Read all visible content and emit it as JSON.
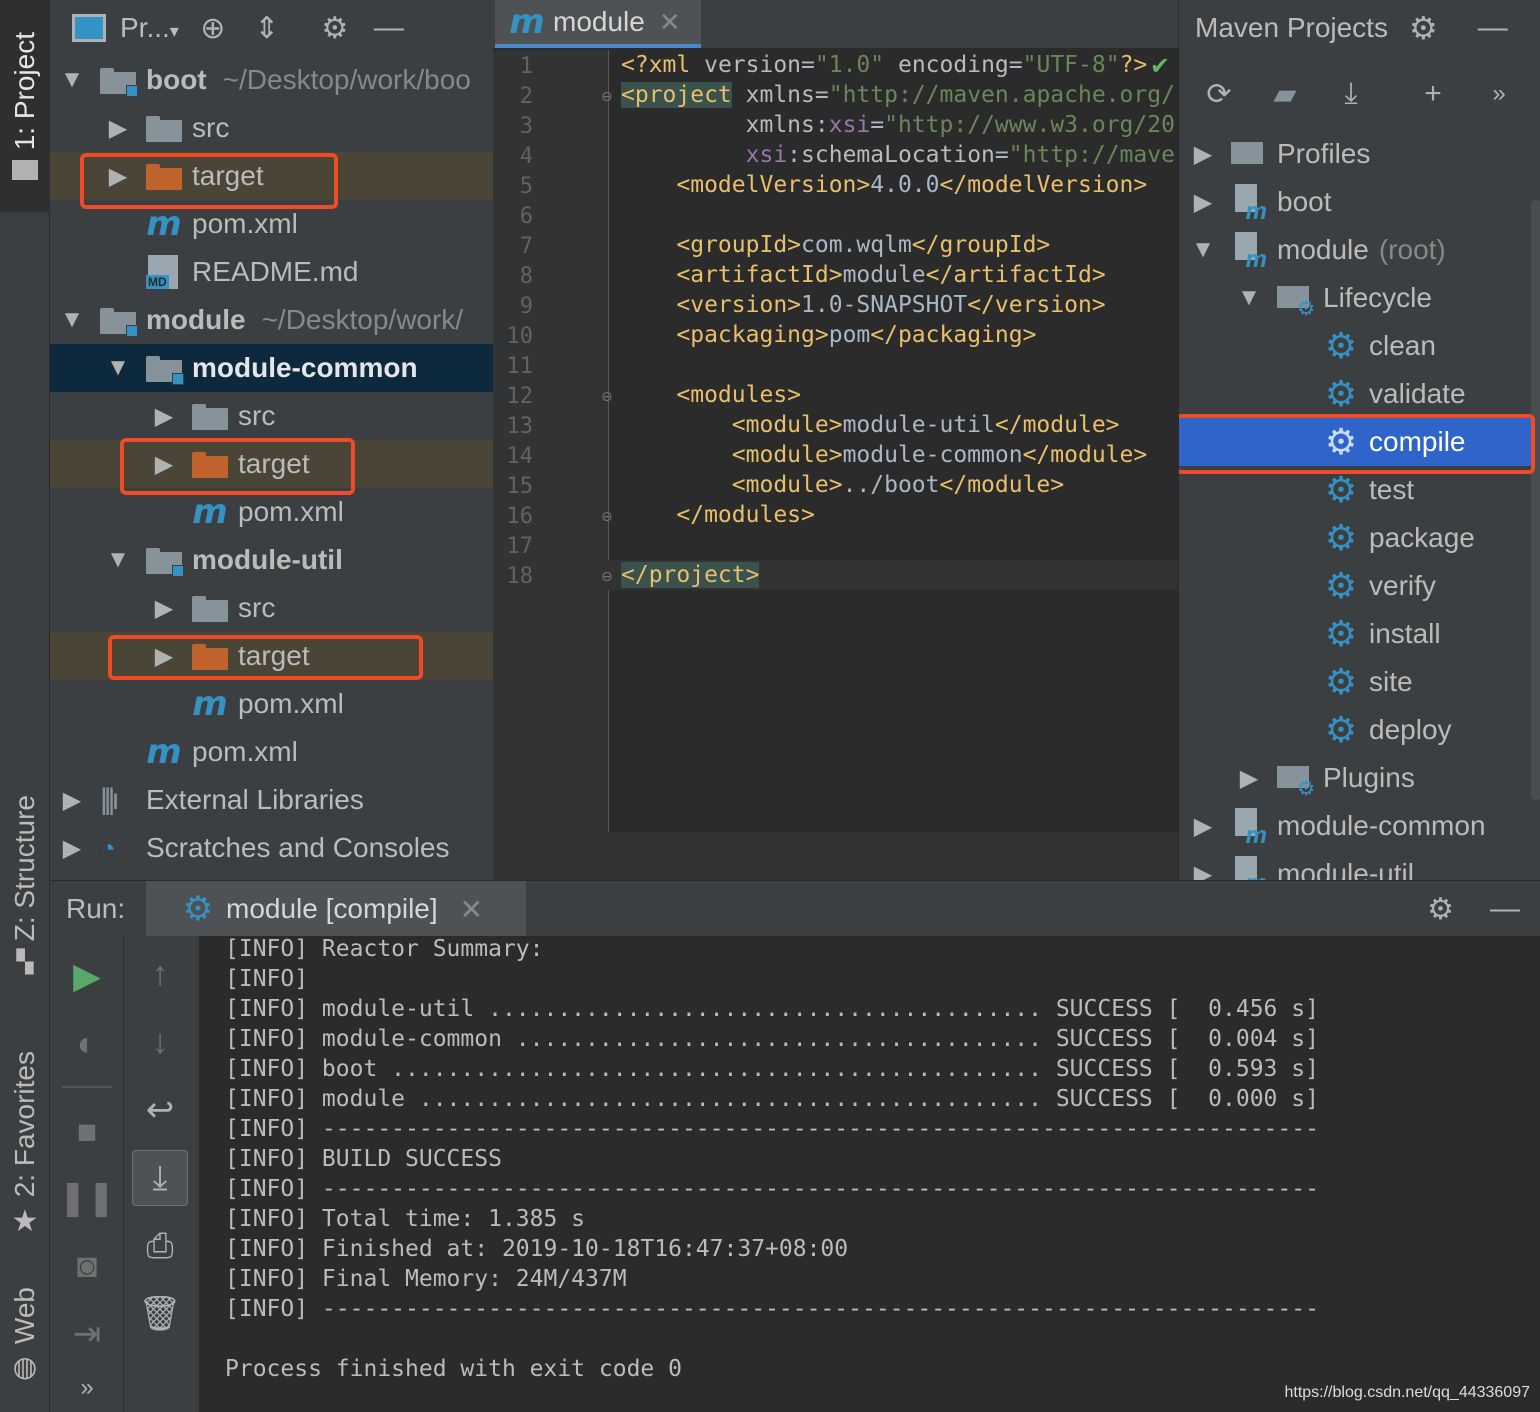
{
  "left_strip": {
    "project_tab": "1: Project",
    "structure_tab": "Z: Structure",
    "favorites_tab": "2: Favorites",
    "web_tab": "Web"
  },
  "project_panel": {
    "title": "Pr...",
    "tree": [
      {
        "label": "boot",
        "path": "~/Desktop/work/boo"
      },
      {
        "label": "src"
      },
      {
        "label": "target"
      },
      {
        "label": "pom.xml"
      },
      {
        "label": "README.md",
        "badge": "MD"
      },
      {
        "label": "module",
        "path": "~/Desktop/work/"
      },
      {
        "label": "module-common"
      },
      {
        "label": "src"
      },
      {
        "label": "target"
      },
      {
        "label": "pom.xml"
      },
      {
        "label": "module-util"
      },
      {
        "label": "src"
      },
      {
        "label": "target"
      },
      {
        "label": "pom.xml"
      },
      {
        "label": "pom.xml"
      },
      {
        "label": "External Libraries"
      },
      {
        "label": "Scratches and Consoles"
      }
    ]
  },
  "editor": {
    "tab_label": "module",
    "line_numbers": [
      "1",
      "2",
      "3",
      "4",
      "5",
      "6",
      "7",
      "8",
      "9",
      "10",
      "11",
      "12",
      "13",
      "14",
      "15",
      "16",
      "17",
      "18"
    ],
    "xml": {
      "decl": "<?xml ",
      "version_attr": "version",
      "version_val": "\"1.0\"",
      "encoding_attr": " encoding",
      "encoding_val": "\"UTF-8\"",
      "decl_end": "?>",
      "project_open": "<project",
      "xmlns_attr": " xmlns",
      "xmlns_val": "\"http://maven.apache.org/",
      "xmlns_xsi_prefix": "xmlns",
      "xmlns_xsi_ns": "xsi",
      "xmlns_xsi_val": "\"http://www.w3.org/20",
      "schema_ns": "xsi",
      "schema_attr": "schemaLocation",
      "schema_val": "\"http://mave",
      "model_version_open": "<modelVersion>",
      "model_version": "4.0.0",
      "model_version_close": "</modelVersion>",
      "group_open": "<groupId>",
      "group": "com.wqlm",
      "group_close": "</groupId>",
      "artifact_open": "<artifactId>",
      "artifact": "module",
      "artifact_close": "</artifactId>",
      "version_open": "<version>",
      "version": "1.0-SNAPSHOT",
      "version_close": "</version>",
      "packaging_open": "<packaging>",
      "packaging": "pom",
      "packaging_close": "</packaging>",
      "modules_open": "<modules>",
      "module_open": "<module>",
      "module_close": "</module>",
      "modules": [
        "module-util",
        "module-common",
        "../boot"
      ],
      "modules_close": "</modules>",
      "project_close": "</project>"
    }
  },
  "maven": {
    "title": "Maven Projects",
    "items": [
      {
        "label": "Profiles"
      },
      {
        "label": "boot"
      },
      {
        "label": "module",
        "suffix": "(root)"
      },
      {
        "label": "Lifecycle"
      },
      {
        "label": "clean"
      },
      {
        "label": "validate"
      },
      {
        "label": "compile"
      },
      {
        "label": "test"
      },
      {
        "label": "package"
      },
      {
        "label": "verify"
      },
      {
        "label": "install"
      },
      {
        "label": "site"
      },
      {
        "label": "deploy"
      },
      {
        "label": "Plugins"
      },
      {
        "label": "module-common"
      },
      {
        "label": "module-util"
      }
    ]
  },
  "run": {
    "label": "Run:",
    "tab_label": "module [compile]",
    "console": [
      "[INFO] Reactor Summary:",
      "[INFO]",
      "[INFO] module-util ........................................ SUCCESS [  0.456 s]",
      "[INFO] module-common ...................................... SUCCESS [  0.004 s]",
      "[INFO] boot ............................................... SUCCESS [  0.593 s]",
      "[INFO] module ............................................. SUCCESS [  0.000 s]",
      "[INFO] ------------------------------------------------------------------------",
      "[INFO] BUILD SUCCESS",
      "[INFO] ------------------------------------------------------------------------",
      "[INFO] Total time: 1.385 s",
      "[INFO] Finished at: 2019-10-18T16:47:37+08:00",
      "[INFO] Final Memory: 24M/437M",
      "[INFO] ------------------------------------------------------------------------",
      "",
      "Process finished with exit code 0"
    ]
  },
  "watermark": "https://blog.csdn.net/qq_44336097",
  "colors": {
    "highlight_box": "#ef4b26",
    "selection": "#2f65ca",
    "maven_blue": "#3592c4",
    "target_folder": "#c0632c"
  }
}
